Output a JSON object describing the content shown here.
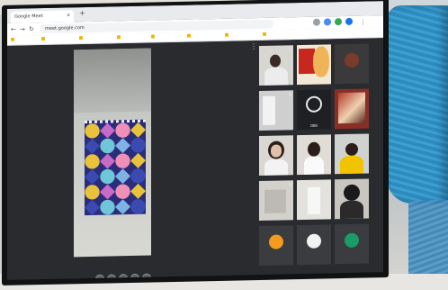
{
  "browser": {
    "tab_title": "Google Meet",
    "url": "meet.google.com",
    "bookmarks": [
      "",
      "",
      "",
      "",
      "",
      "",
      "",
      ""
    ]
  },
  "meeting": {
    "participants": [
      {
        "name": ""
      },
      {
        "name": ""
      },
      {
        "name": ""
      },
      {
        "name": ""
      },
      {
        "name": "OBS"
      },
      {
        "name": ""
      },
      {
        "name": ""
      },
      {
        "name": ""
      },
      {
        "name": ""
      },
      {
        "name": ""
      },
      {
        "name": ""
      },
      {
        "name": ""
      },
      {
        "name": ""
      },
      {
        "name": ""
      },
      {
        "name": ""
      }
    ]
  },
  "colors": {
    "accent_red": "#b2342a",
    "quilt_blue": "#2a2e7a",
    "obs_dark": "#1e2024"
  }
}
